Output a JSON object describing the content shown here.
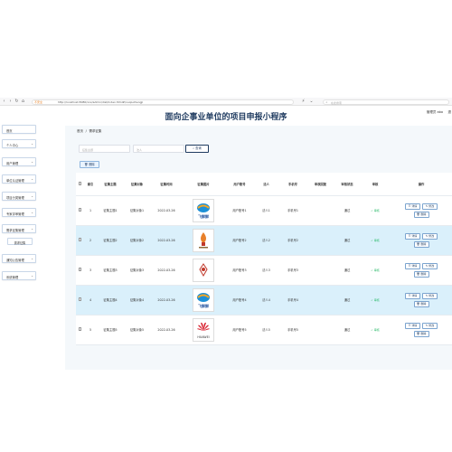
{
  "browser": {
    "secure_label": "不安全",
    "url": "http://localhost:8080/xxx/admin/dist/index.html#/xuqiuzhengji",
    "search_placeholder": "在此搜索"
  },
  "header": {
    "title": "面向企事业单位的项目申报小程序",
    "user": "管理员 abo",
    "logout": "退"
  },
  "sidebar": {
    "items": [
      {
        "label": "首页",
        "arrow": ""
      },
      {
        "label": "个人中心",
        "arrow": "⌄"
      },
      {
        "label": "用户管理",
        "arrow": "⌄"
      },
      {
        "label": "单位认证管理",
        "arrow": "⌄"
      },
      {
        "label": "项目分类管理",
        "arrow": "⌄"
      },
      {
        "label": "专家评审管理",
        "arrow": "⌄"
      },
      {
        "label": "需求征集管理",
        "arrow": "⌄"
      },
      {
        "label": "需求征集",
        "arrow": ""
      },
      {
        "label": "通知公告管理",
        "arrow": "⌄"
      },
      {
        "label": "系统管理",
        "arrow": "⌄"
      }
    ]
  },
  "breadcrumb": {
    "home": "首页",
    "sep": "/",
    "current": "需求征集"
  },
  "filters": {
    "topic_placeholder": "征集主题",
    "corp_placeholder": "法人",
    "query_label": "查询",
    "query_icon": "search-icon"
  },
  "toolbar": {
    "delete_label": "删除"
  },
  "table": {
    "columns": [
      "",
      "索引",
      "征集主题",
      "征集对象",
      "征集时间",
      "征集图片",
      "用户账号",
      "法人",
      "手机号",
      "审核回复",
      "审核状态",
      "审核",
      "操作"
    ],
    "rows": [
      {
        "index": "1",
        "topic": "征集主题1",
        "target": "征集对象1",
        "time": "2022-03-26",
        "logo": "飞鲜鲜",
        "account": "用户账号1",
        "corp": "法人1",
        "phone": "手机号1",
        "reply": "",
        "status": "通过",
        "audit": "审核"
      },
      {
        "index": "2",
        "topic": "征集主题2",
        "target": "征集对象2",
        "time": "2022-03-26",
        "logo": "",
        "account": "用户账号2",
        "corp": "法人2",
        "phone": "手机号2",
        "reply": "",
        "status": "通过",
        "audit": "审核"
      },
      {
        "index": "3",
        "topic": "征集主题3",
        "target": "征集对象3",
        "time": "2022-03-26",
        "logo": "",
        "account": "用户账号3",
        "corp": "法人3",
        "phone": "手机号3",
        "reply": "",
        "status": "通过",
        "audit": "审核"
      },
      {
        "index": "4",
        "topic": "征集主题4",
        "target": "征集对象4",
        "time": "2022-03-26",
        "logo": "飞鲜鲜",
        "account": "用户账号4",
        "corp": "法人4",
        "phone": "手机号4",
        "reply": "",
        "status": "通过",
        "audit": "审核"
      },
      {
        "index": "5",
        "topic": "征集主题5",
        "target": "征集对象5",
        "time": "2022-03-26",
        "logo": "HUAWEI",
        "account": "用户账号5",
        "corp": "法人5",
        "phone": "手机号5",
        "reply": "",
        "status": "通过",
        "audit": "审核"
      }
    ],
    "op_labels": {
      "detail": "详情",
      "edit": "修改",
      "delete": "删除"
    }
  },
  "colors": {
    "title": "#1e3a5f",
    "stripe": "#daf0fb",
    "status_green": "#2cba6b",
    "accent": "#7ba4cf"
  }
}
